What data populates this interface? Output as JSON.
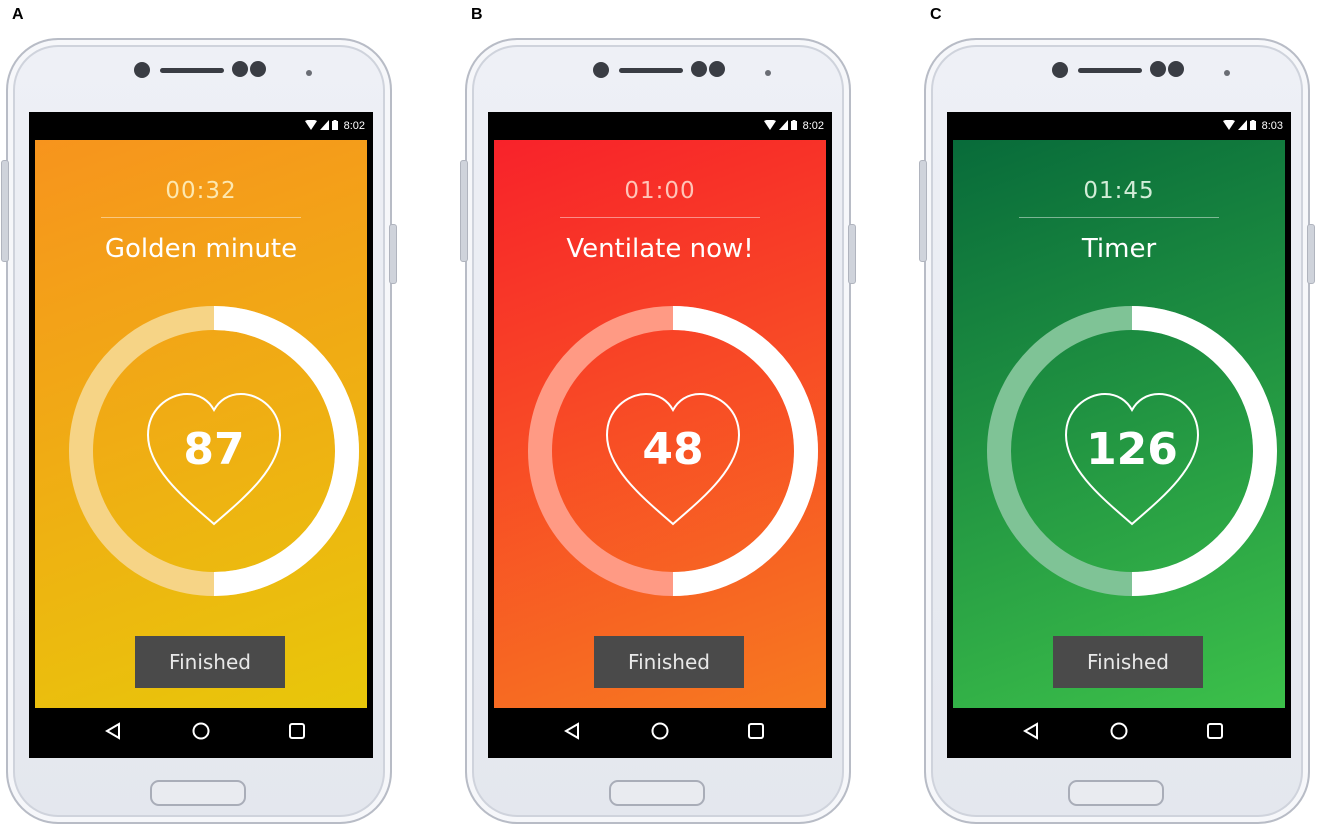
{
  "panels": [
    {
      "label": "A",
      "status_time": "8:02",
      "timer": "00:32",
      "title": "Golden minute",
      "heart_rate": "87",
      "progress_fraction": 0.5,
      "finish_label": "Finished",
      "colors": {
        "bg_start": "#f7941d",
        "bg_end": "#e8c70a",
        "timer_text": "#fde8b0",
        "track": "#f6d486"
      }
    },
    {
      "label": "B",
      "status_time": "8:02",
      "timer": "01:00",
      "title": "Ventilate now!",
      "heart_rate": "48",
      "progress_fraction": 0.5,
      "finish_label": "Finished",
      "colors": {
        "bg_start": "#f8222a",
        "bg_end": "#f77a20",
        "timer_text": "#ffc4b8",
        "track": "#ff9a84"
      }
    },
    {
      "label": "C",
      "status_time": "8:03",
      "timer": "01:45",
      "title": "Timer",
      "heart_rate": "126",
      "progress_fraction": 0.5,
      "finish_label": "Finished",
      "colors": {
        "bg_start": "#086b3a",
        "bg_end": "#3cc04a",
        "timer_text": "#d2ecd7",
        "track": "#7fc396"
      }
    }
  ],
  "icons": [
    "wifi-icon",
    "signal-icon",
    "battery-icon",
    "back-icon",
    "home-icon",
    "recents-icon",
    "heart-icon"
  ]
}
